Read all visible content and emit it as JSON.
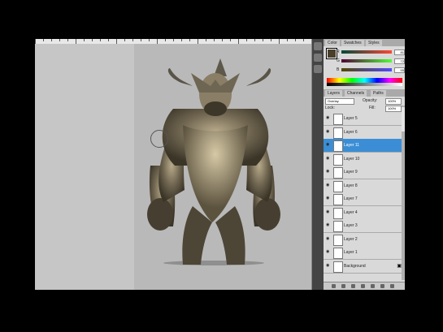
{
  "color_panel": {
    "tabs": [
      "Color",
      "Swatches",
      "Styles"
    ],
    "channels": [
      {
        "label": "R",
        "value": "81"
      },
      {
        "label": "G",
        "value": "72"
      },
      {
        "label": "B",
        "value": "55"
      }
    ]
  },
  "layers_panel": {
    "tabs": [
      "Layers",
      "Channels",
      "Paths"
    ],
    "blend_mode": "Overlay",
    "opacity_label": "Opacity:",
    "opacity_value": "100%",
    "lock_label": "Lock:",
    "fill_label": "Fill:",
    "fill_value": "100%",
    "layers": [
      {
        "name": "Layer 5",
        "active": false
      },
      {
        "name": "Layer 6",
        "active": false
      },
      {
        "name": "Layer 11",
        "active": true
      },
      {
        "name": "Layer 10",
        "active": false
      },
      {
        "name": "Layer 9",
        "active": false
      },
      {
        "name": "Layer 8",
        "active": false
      },
      {
        "name": "Layer 7",
        "active": false
      },
      {
        "name": "Layer 4",
        "active": false
      },
      {
        "name": "Layer 3",
        "active": false
      },
      {
        "name": "Layer 2",
        "active": false
      },
      {
        "name": "Layer 1",
        "active": false
      },
      {
        "name": "Background",
        "active": false,
        "locked": true
      }
    ]
  }
}
